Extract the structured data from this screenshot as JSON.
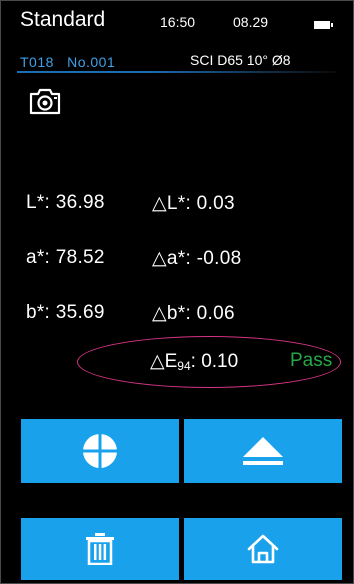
{
  "header": {
    "title": "Standard",
    "time": "16:50",
    "date": "08.29",
    "battery_icon": "battery-icon",
    "sample_id": "T018",
    "number": "No.001",
    "settings": "SCI D65 10° Ø8"
  },
  "camera_icon": "camera-icon",
  "measurements": {
    "L_label": "L*:",
    "L_value": "36.98",
    "a_label": "a*:",
    "a_value": "78.52",
    "b_label": "b*:",
    "b_value": "35.69",
    "dL_label": "△L*:",
    "dL_value": "0.03",
    "da_label": "△a*:",
    "da_value": "-0.08",
    "db_label": "△b*:",
    "db_value": "0.06",
    "dE_label": "△E",
    "dE_sub": "94",
    "dE_value": ": 0.10",
    "result": "Pass"
  },
  "buttons": [
    {
      "icon": "crosshair-circle-icon"
    },
    {
      "icon": "eject-icon"
    },
    {
      "icon": "trash-icon"
    },
    {
      "icon": "home-icon"
    }
  ],
  "colors": {
    "accent_blue": "#1aa1ec",
    "sub_blue": "#3fa0e8",
    "pass_green": "#27a844",
    "ellipse_magenta": "#d43584"
  }
}
